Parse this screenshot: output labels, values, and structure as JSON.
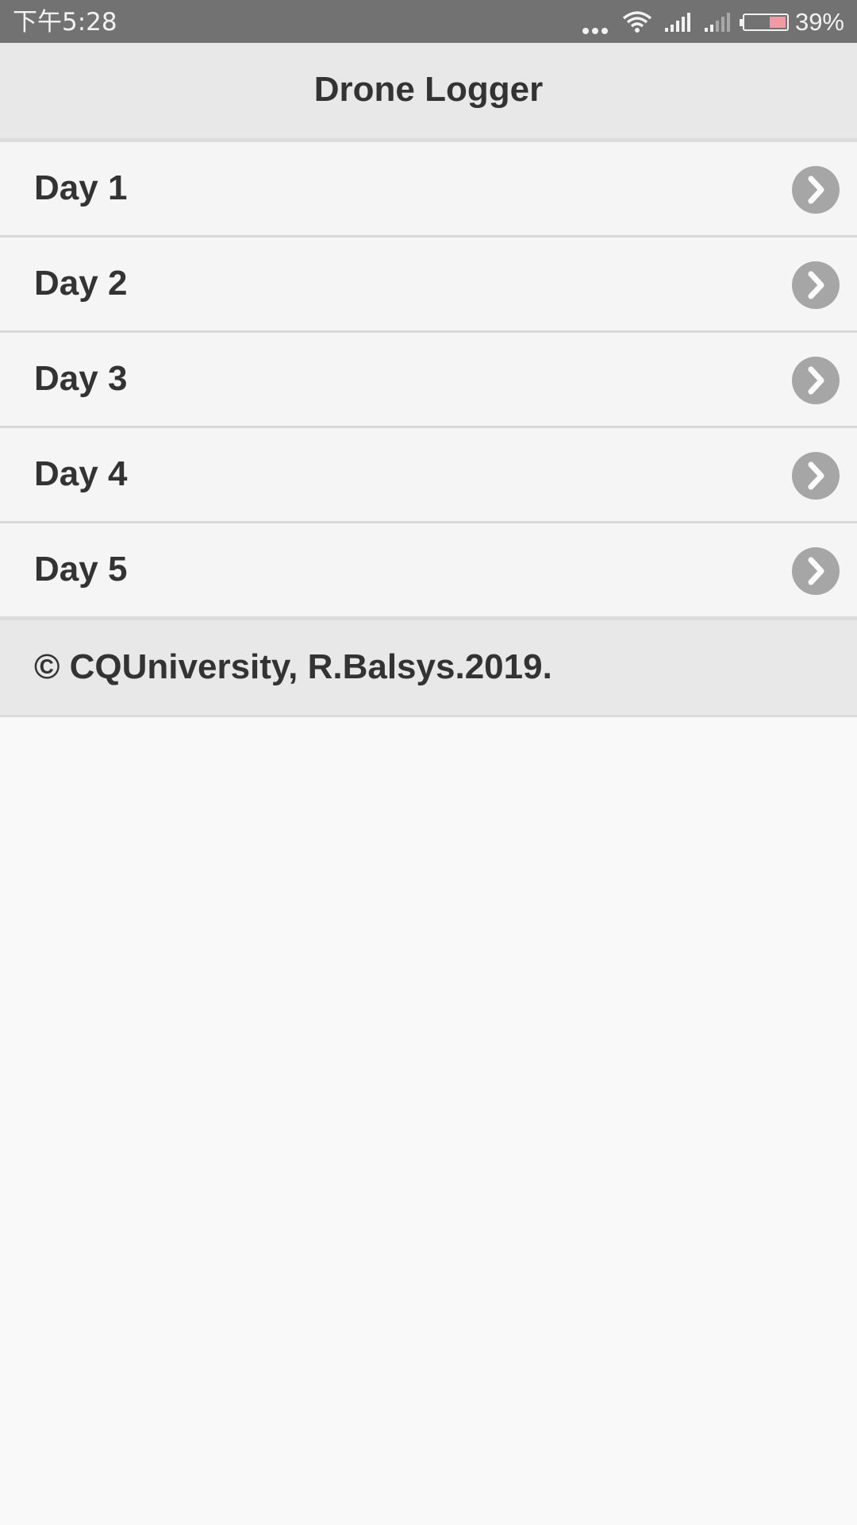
{
  "status_bar": {
    "time": "下午5:28",
    "battery_percent": "39%",
    "battery_level": 0.39,
    "icons": [
      "more-dots-icon",
      "wifi-icon",
      "signal-icon",
      "signal-weak-icon",
      "battery-icon"
    ]
  },
  "header": {
    "title": "Drone Logger"
  },
  "list": {
    "items": [
      {
        "label": "Day 1"
      },
      {
        "label": "Day 2"
      },
      {
        "label": "Day 3"
      },
      {
        "label": "Day 4"
      },
      {
        "label": "Day 5"
      }
    ]
  },
  "footer": {
    "text": "© CQUniversity, R.Balsys.2019."
  },
  "colors": {
    "status_bar_bg": "#727272",
    "header_bg": "#e8e8e8",
    "list_bg": "#f5f5f5",
    "chevron_bg": "#a6a6a6",
    "text": "#333333",
    "battery_fill": "#f29aa3"
  }
}
